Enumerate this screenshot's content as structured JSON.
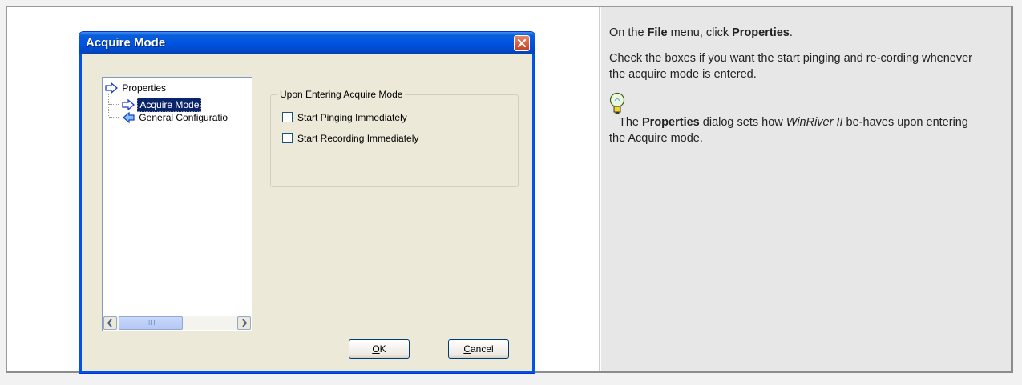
{
  "dialog": {
    "title": "Acquire Mode",
    "tree": {
      "root_label": "Properties",
      "items": [
        {
          "label": "Acquire Mode",
          "selected": true
        },
        {
          "label": "General Configuratio",
          "selected": false
        }
      ],
      "scrollbar_grip": "III"
    },
    "groupbox": {
      "title": "Upon Entering Acquire Mode",
      "checkboxes": [
        {
          "label": "Start Pinging Immediately",
          "checked": false
        },
        {
          "label": "Start Recording Immediately",
          "checked": false
        }
      ]
    },
    "buttons": {
      "ok_mnemonic": "O",
      "ok_rest": "K",
      "cancel_mnemonic": "C",
      "cancel_rest": "ancel"
    }
  },
  "instructions": {
    "step1": {
      "prefix": "On the ",
      "menu": "File",
      "middle": " menu, click ",
      "item": "Properties",
      "suffix": "."
    },
    "step2": "Check the boxes if you want the start pinging and re-cording whenever the acquire mode is entered.",
    "tip": {
      "prefix": "The ",
      "bold": "Properties",
      "middle": " dialog sets how ",
      "italic": "WinRiver II",
      "suffix": " be-haves upon entering the Acquire mode."
    }
  },
  "colors": {
    "titlebar": "#0054e3",
    "dialog_bg": "#ece9d8",
    "right_panel_bg": "#e7e7e7",
    "tree_selection": "#0a246a"
  },
  "icons": [
    "close-icon",
    "blue-arrow-icon",
    "lightbulb-icon",
    "scroll-left-icon",
    "scroll-right-icon"
  ]
}
